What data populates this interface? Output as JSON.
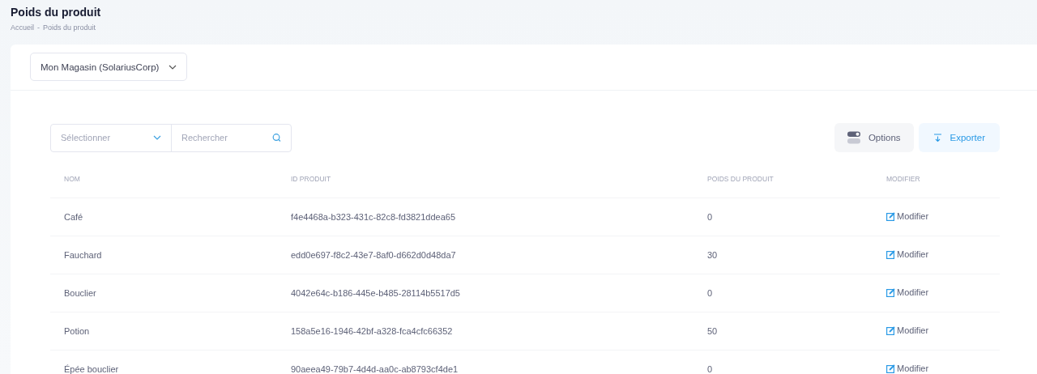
{
  "page_title": "Poids du produit",
  "breadcrumb": [
    "Accueil",
    "Poids du produit"
  ],
  "breadcrumb_separator": "-",
  "store_select": {
    "value": "Mon Magasin (SolariusCorp)"
  },
  "filter_select": {
    "placeholder": "Sélectionner"
  },
  "search": {
    "placeholder": "Rechercher"
  },
  "buttons": [
    {
      "kind": "options",
      "label": "Options"
    },
    {
      "kind": "export",
      "label": "Exporter"
    }
  ],
  "table": {
    "columns": [
      "NOM",
      "ID PRODUIT",
      "POIDS DU PRODUIT",
      "MODIFIER"
    ],
    "rows": [
      {
        "name": "Café",
        "id": "f4e4468a-b323-431c-82c8-fd3821ddea65",
        "weight": "0",
        "action": "Modifier"
      },
      {
        "name": "Fauchard",
        "id": "edd0e697-f8c2-43e7-8af0-d662d0d48da7",
        "weight": "30",
        "action": "Modifier"
      },
      {
        "name": "Bouclier",
        "id": "4042e64c-b186-445e-b485-28114b5517d5",
        "weight": "0",
        "action": "Modifier"
      },
      {
        "name": "Potion",
        "id": "158a5e16-1946-42bf-a328-fca4cfc66352",
        "weight": "50",
        "action": "Modifier"
      },
      {
        "name": "Épée bouclier",
        "id": "90aeea49-79b7-4d4d-aa0c-ab8793cf4de1",
        "weight": "0",
        "action": "Modifier"
      }
    ]
  }
}
